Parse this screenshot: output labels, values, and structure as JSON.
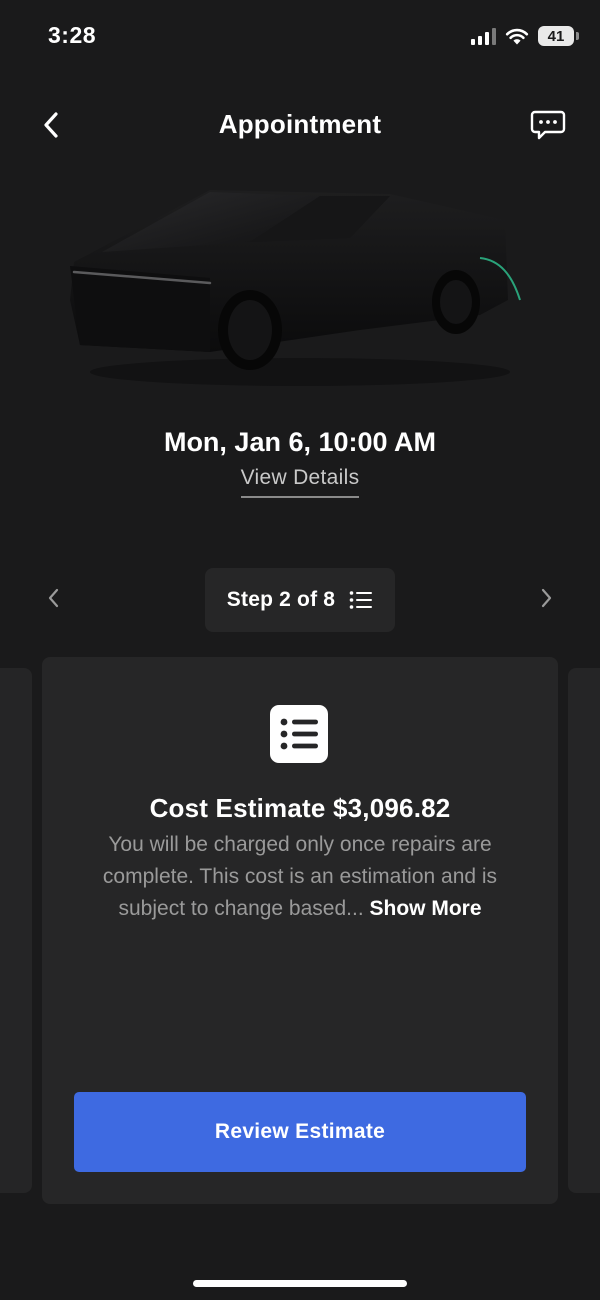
{
  "status_bar": {
    "time": "3:28",
    "battery": "41",
    "icons": [
      "cellular-signal-icon",
      "wifi-icon",
      "battery-icon"
    ]
  },
  "header": {
    "title": "Appointment",
    "back_icon": "chevron-left-icon",
    "chat_icon": "chat-bubble-icon"
  },
  "appointment": {
    "datetime": "Mon, Jan 6, 10:00 AM",
    "view_details_label": "View Details"
  },
  "steps": {
    "label": "Step 2 of 8",
    "current": 2,
    "total": 8,
    "list_icon": "list-icon",
    "prev_icon": "chevron-left-icon",
    "next_icon": "chevron-right-icon"
  },
  "card": {
    "icon": "list-icon",
    "title": "Cost Estimate $3,096.82",
    "description": "You will be charged only once repairs are complete. This cost is an estimation and is subject to change based...",
    "show_more_label": "Show More",
    "button_label": "Review Estimate"
  },
  "colors": {
    "background": "#1a1a1b",
    "card": "#262627",
    "primary_button": "#3e6ae1",
    "muted_text": "#9a9a9a"
  }
}
